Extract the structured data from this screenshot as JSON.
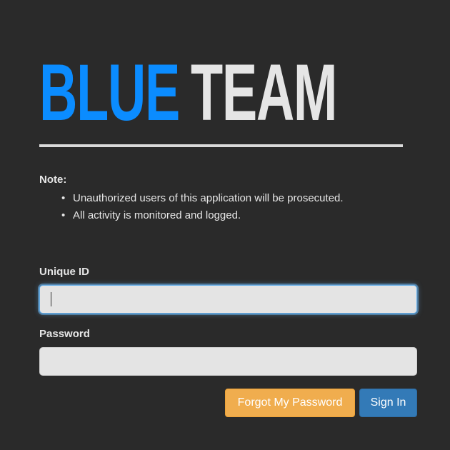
{
  "logo": {
    "part1": "BLUE",
    "part2": "TEAM"
  },
  "note": {
    "title": "Note:",
    "items": [
      "Unauthorized users of this application will be prosecuted.",
      "All activity is monitored and logged."
    ],
    "bullet": "•"
  },
  "form": {
    "unique_id_label": "Unique ID",
    "unique_id_value": "",
    "password_label": "Password",
    "password_value": ""
  },
  "buttons": {
    "forgot_label": "Forgot My Password",
    "signin_label": "Sign In"
  },
  "colors": {
    "background": "#2a2a2a",
    "logo_blue": "#0b8cff",
    "logo_gray": "#e5e5e5",
    "forgot_button": "#f0ad4e",
    "signin_button": "#337ab7",
    "focus_ring": "#66afe9"
  }
}
